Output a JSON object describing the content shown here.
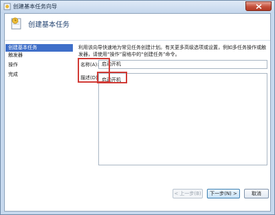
{
  "window": {
    "title": "创建基本任务向导"
  },
  "header": {
    "title": "创建基本任务"
  },
  "sidebar": {
    "steps": [
      {
        "label": "创建基本任务"
      },
      {
        "label": "触发器"
      },
      {
        "label": "操作"
      },
      {
        "label": "完成"
      }
    ]
  },
  "main": {
    "description": "利用该向导快速地为常见任务创建计划。有关更多高级选项或设置，例如多任务操作或触发器，请使用“操作”窗格中的“创建任务”命令。",
    "name_label": "名称(A):",
    "name_value": "启动开机",
    "desc_label": "描述(D):",
    "desc_value": "启动开机"
  },
  "buttons": {
    "back": "< 上一步(B)",
    "next": "下一步(N) >",
    "cancel": "取消"
  },
  "colors": {
    "accent": "#3f6fc9",
    "highlight": "#d13a35"
  }
}
